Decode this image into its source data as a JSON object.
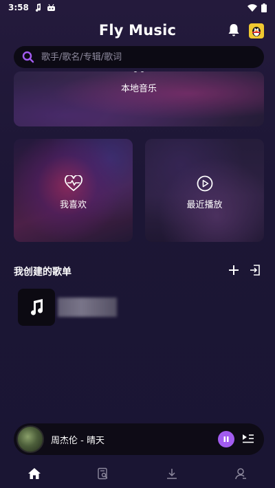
{
  "status_bar": {
    "time": "3:58"
  },
  "header": {
    "title": "Fly Music"
  },
  "search": {
    "placeholder": "歌手/歌名/专辑/歌词"
  },
  "cards": {
    "local": {
      "label": "本地音乐"
    },
    "favorites": {
      "label": "我喜欢"
    },
    "recent": {
      "label": "最近播放"
    }
  },
  "playlists": {
    "title": "我创建的歌单",
    "items": [
      {
        "name": ""
      }
    ]
  },
  "player": {
    "song": "周杰伦 - 晴天",
    "state": "playing"
  },
  "bottom_nav": {
    "items": [
      {
        "icon": "home-icon",
        "active": true
      },
      {
        "icon": "playlist-search-icon",
        "active": false
      },
      {
        "icon": "download-icon",
        "active": false
      },
      {
        "icon": "profile-icon",
        "active": false
      }
    ]
  },
  "colors": {
    "background": "#1c1635",
    "accent": "#a25cf0",
    "search_bg": "#0c0a14"
  }
}
